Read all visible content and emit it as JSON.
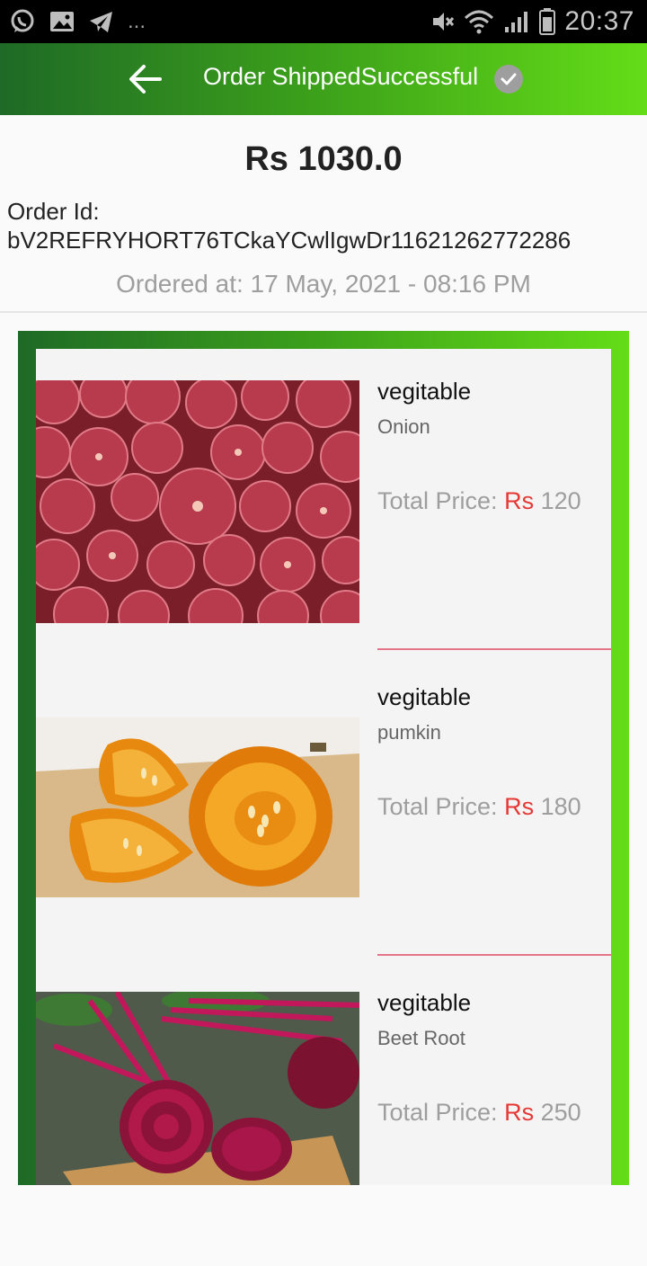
{
  "status_bar": {
    "time": "20:37",
    "dots": "...",
    "left_icons": [
      "whatsapp-icon",
      "image-icon",
      "telegram-icon"
    ],
    "right_icons": [
      "mute-icon",
      "wifi-icon",
      "signal-icon",
      "battery-icon"
    ]
  },
  "app_bar": {
    "title": "Order ShippedSuccessful",
    "back_icon": "arrow-left-icon",
    "status_icon": "check-circle-icon",
    "gradient": [
      "#1e6a26",
      "#64dd17"
    ]
  },
  "order": {
    "total": "Rs 1030.0",
    "id_label": "Order Id:",
    "id_value": "bV2REFRYHORT76TCkaYCwlIgwDr11621262772286",
    "ordered_at": "Ordered at: 17 May, 2021 - 08:16 PM"
  },
  "items": [
    {
      "category": "vegitable",
      "name": "Onion",
      "price_label": "Total Price:",
      "currency": "Rs",
      "price": "120",
      "image": "onion-photo"
    },
    {
      "category": "vegitable",
      "name": "pumkin",
      "price_label": "Total Price:",
      "currency": "Rs",
      "price": "180",
      "image": "pumpkin-photo"
    },
    {
      "category": "vegitable",
      "name": "Beet Root",
      "price_label": "Total Price:",
      "currency": "Rs",
      "price": "250",
      "image": "beetroot-photo"
    }
  ],
  "colors": {
    "price_currency": "#e53935",
    "divider": "#e57389",
    "muted": "#9e9e9e"
  }
}
